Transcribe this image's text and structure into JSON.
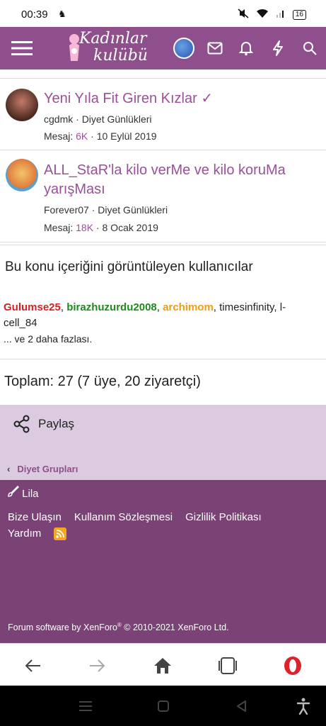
{
  "status": {
    "time": "00:39",
    "battery": "16"
  },
  "brand": {
    "line1": "Kadınlar",
    "line2": "kulübü"
  },
  "threads": [
    {
      "title": "Yeni Yıla Fit Giren Kızlar ✓",
      "author": "cgdmk",
      "forum": "Diyet Günlükleri",
      "messages_label": "Mesaj:",
      "messages": "6K",
      "date": "10 Eylül 2019"
    },
    {
      "title": "ALL_StaR'la kilo verMe ve kilo koruMa yarışMası",
      "author": "Forever07",
      "forum": "Diyet Günlükleri",
      "messages_label": "Mesaj:",
      "messages": "18K",
      "date": "8 Ocak 2019"
    }
  ],
  "viewers": {
    "title": "Bu konu içeriğini görüntüleyen kullanıcılar",
    "users": [
      "Gulumse25",
      "birazhuzurdu2008",
      "archimom",
      "timesinfinity",
      "l-cell_84"
    ],
    "more": "... ve 2 daha fazlası."
  },
  "total": "Toplam: 27 (7 üye, 20 ziyaretçi)",
  "share": {
    "label": "Paylaş"
  },
  "breadcrumb": {
    "label": "Diyet Grupları"
  },
  "footer": {
    "style": "Lila",
    "links": [
      "Bize Ulaşın",
      "Kullanım Sözleşmesi",
      "Gizlilik Politikası",
      "Yardım"
    ],
    "copyright_prefix": "Forum software by XenForo",
    "copyright_reg": "®",
    "copyright_suffix": " © 2010-2021 XenForo Ltd."
  },
  "colors": {
    "brand": "#8e4f8c",
    "footer": "#7a4275",
    "share_bg": "#dccbe0",
    "link": "#9a4f98"
  }
}
